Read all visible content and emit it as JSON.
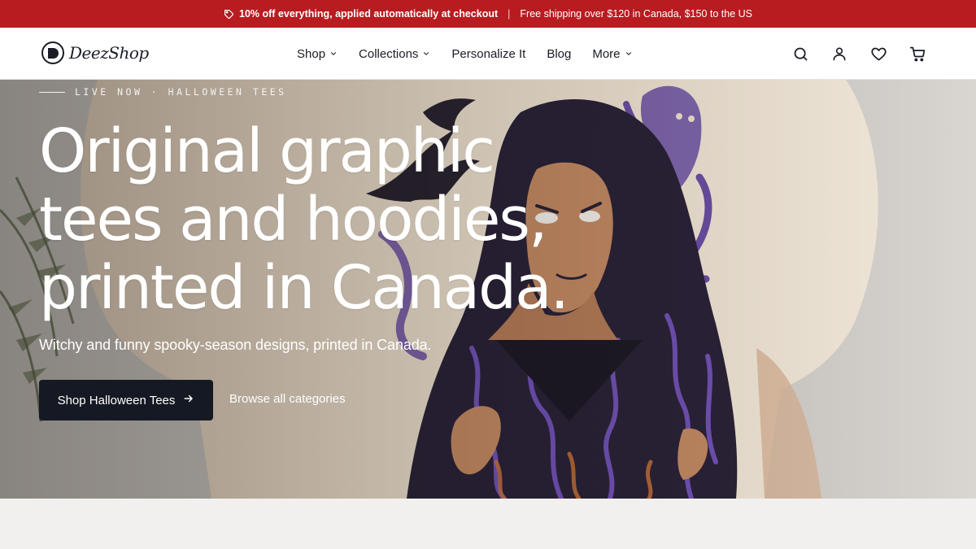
{
  "announcement": {
    "promo_icon": "tag-icon",
    "promo_text": "10% off everything, applied automatically at checkout",
    "separator": "|",
    "shipping_text": "Free shipping over $120 in Canada, $150 to the US",
    "background": "#b81c20"
  },
  "header": {
    "logo_text": "DeezShop",
    "nav": [
      {
        "label": "Shop",
        "has_dropdown": true
      },
      {
        "label": "Collections",
        "has_dropdown": true
      },
      {
        "label": "Personalize It",
        "has_dropdown": false
      },
      {
        "label": "Blog",
        "has_dropdown": false
      },
      {
        "label": "More",
        "has_dropdown": true
      }
    ],
    "icons": [
      "search-icon",
      "account-icon",
      "heart-icon",
      "cart-icon"
    ]
  },
  "hero": {
    "eyebrow": "LIVE NOW · HALLOWEEN TEES",
    "headline_lines": [
      "Original graphic",
      "tees and hoodies,",
      "printed in Canada."
    ],
    "subhead": "Witchy and funny spooky-season designs, printed in Canada.",
    "primary_cta": "Shop Halloween Tees",
    "secondary_cta": "Browse all categories",
    "accent_dark": "#151923"
  }
}
